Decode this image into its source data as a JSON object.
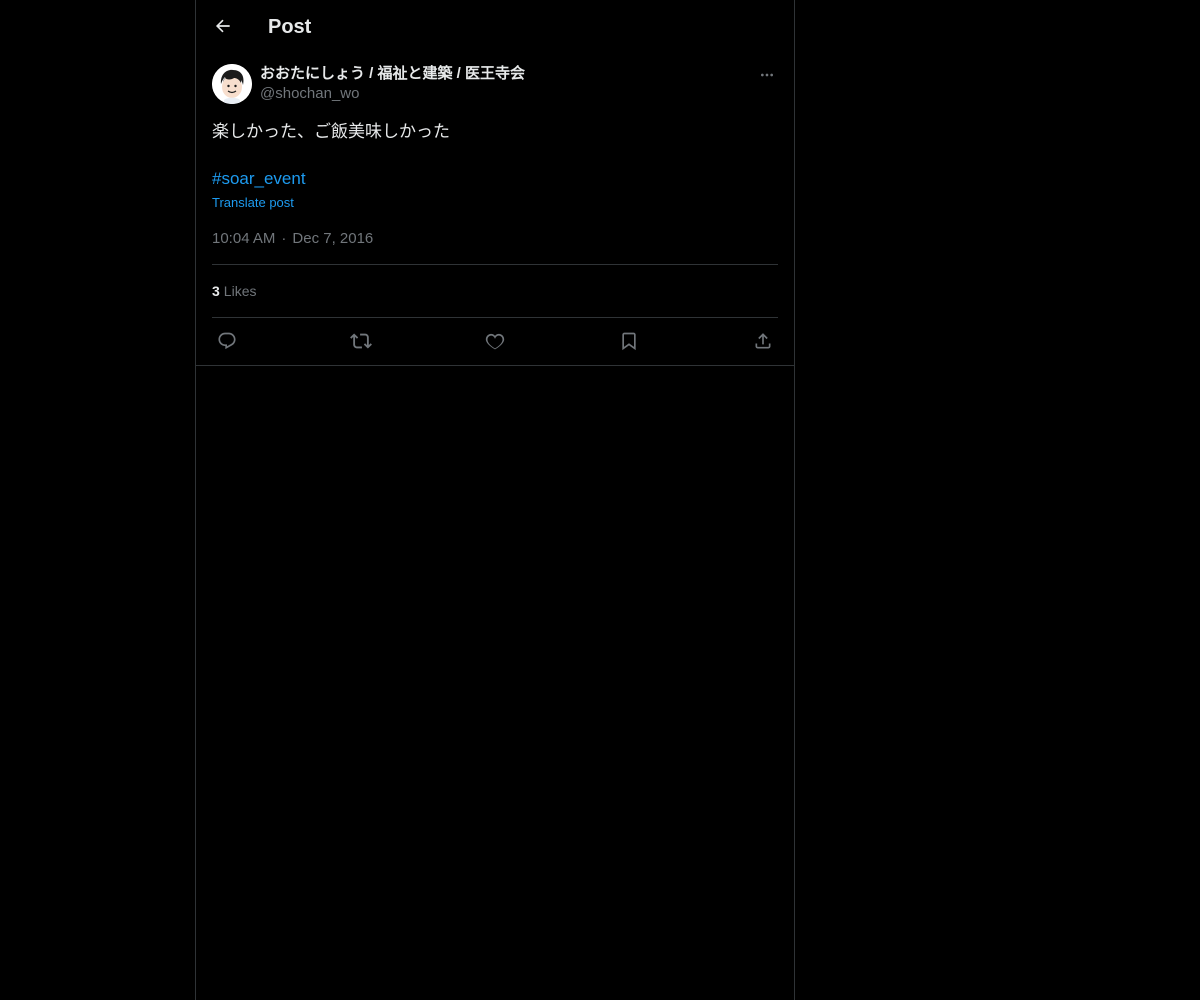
{
  "header": {
    "title": "Post",
    "back_icon": "arrow-left-icon"
  },
  "post": {
    "author": {
      "name": "おおたにしょう / 福祉と建築 / 医王寺会",
      "handle": "@shochan_wo"
    },
    "text": "楽しかった、ご飯美味しかった",
    "hashtag": "#soar_event",
    "translate_label": "Translate post",
    "time": "10:04 AM",
    "separator": "·",
    "date": "Dec 7, 2016",
    "likes": {
      "count": "3",
      "label": "Likes"
    },
    "actions": [
      {
        "icon": "reply-icon"
      },
      {
        "icon": "repost-icon"
      },
      {
        "icon": "like-icon"
      },
      {
        "icon": "bookmark-icon"
      },
      {
        "icon": "share-icon"
      }
    ]
  },
  "colors": {
    "background": "#000000",
    "text": "#e7e9ea",
    "secondary": "#71767b",
    "accent": "#1d9bf0",
    "border": "#2f3336"
  }
}
